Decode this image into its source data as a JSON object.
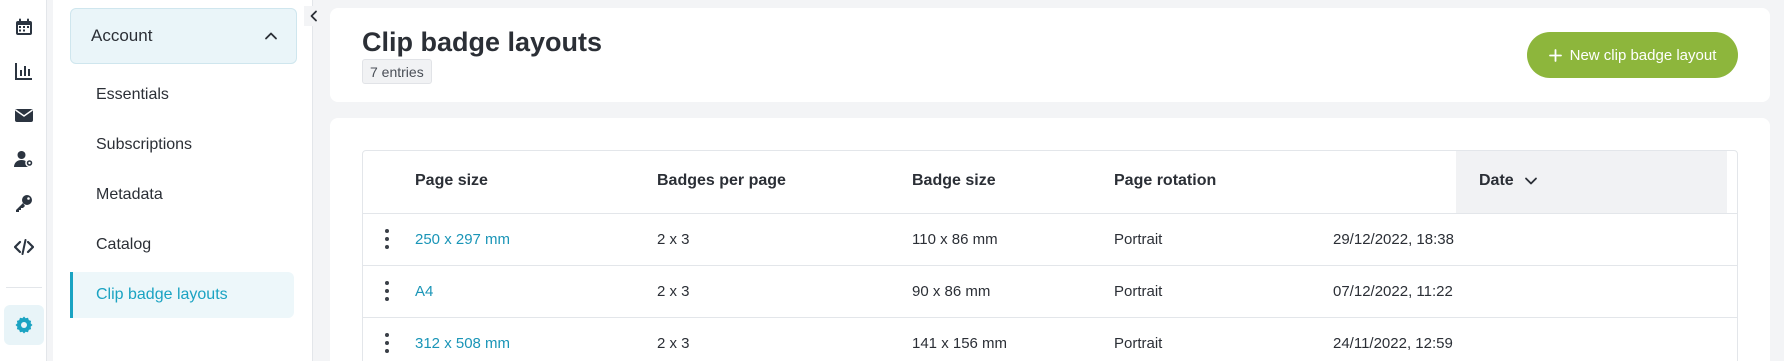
{
  "rail": {
    "icons": [
      "calendar-icon",
      "chart-icon",
      "mail-icon",
      "user-gear-icon",
      "key-icon",
      "code-icon",
      "gear-icon"
    ]
  },
  "sidebar": {
    "section": "Account",
    "items": [
      {
        "label": "Essentials"
      },
      {
        "label": "Subscriptions"
      },
      {
        "label": "Metadata"
      },
      {
        "label": "Catalog"
      },
      {
        "label": "Clip badge layouts"
      }
    ],
    "active_item": "Clip badge layouts"
  },
  "header": {
    "title": "Clip badge layouts",
    "entries": "7 entries",
    "new_button": "New clip badge layout"
  },
  "table": {
    "columns": [
      "Page size",
      "Badges per page",
      "Badge size",
      "Page rotation",
      "Date"
    ],
    "sorted_column": "Date",
    "rows": [
      {
        "page_size": "250 x 297 mm",
        "badges_per_page": "2 x 3",
        "badge_size": "110 x 86 mm",
        "rotation": "Portrait",
        "date": "29/12/2022, 18:38"
      },
      {
        "page_size": "A4",
        "badges_per_page": "2 x 3",
        "badge_size": "90 x 86 mm",
        "rotation": "Portrait",
        "date": "07/12/2022, 11:22"
      },
      {
        "page_size": "312 x 508 mm",
        "badges_per_page": "2 x 3",
        "badge_size": "141 x 156 mm",
        "rotation": "Portrait",
        "date": "24/11/2022, 12:59"
      }
    ]
  },
  "colors": {
    "accent": "#1aa3c2",
    "primary_button": "#8db63c"
  }
}
